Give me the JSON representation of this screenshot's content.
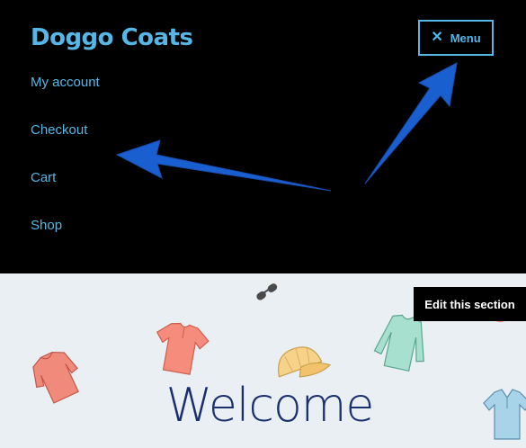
{
  "header": {
    "site_title": "Doggo Coats",
    "menu_button_label": "Menu",
    "nav_items": [
      "My account",
      "Checkout",
      "Cart",
      "Shop"
    ]
  },
  "hero": {
    "heading": "Welcome",
    "edit_button_label": "Edit this section"
  },
  "colors": {
    "header_bg": "#000000",
    "link": "#56b7e6",
    "hero_bg": "#e9eff3",
    "heading": "#1a2f6e",
    "annotation_arrow": "#1a5fd0"
  },
  "icons": {
    "menu_close": "close-icon",
    "decorations": [
      "sunglasses-icon",
      "tshirt-icon",
      "sweater-icon",
      "cap-icon",
      "long-sleeve-shirt-icon",
      "polo-shirt-icon"
    ]
  }
}
